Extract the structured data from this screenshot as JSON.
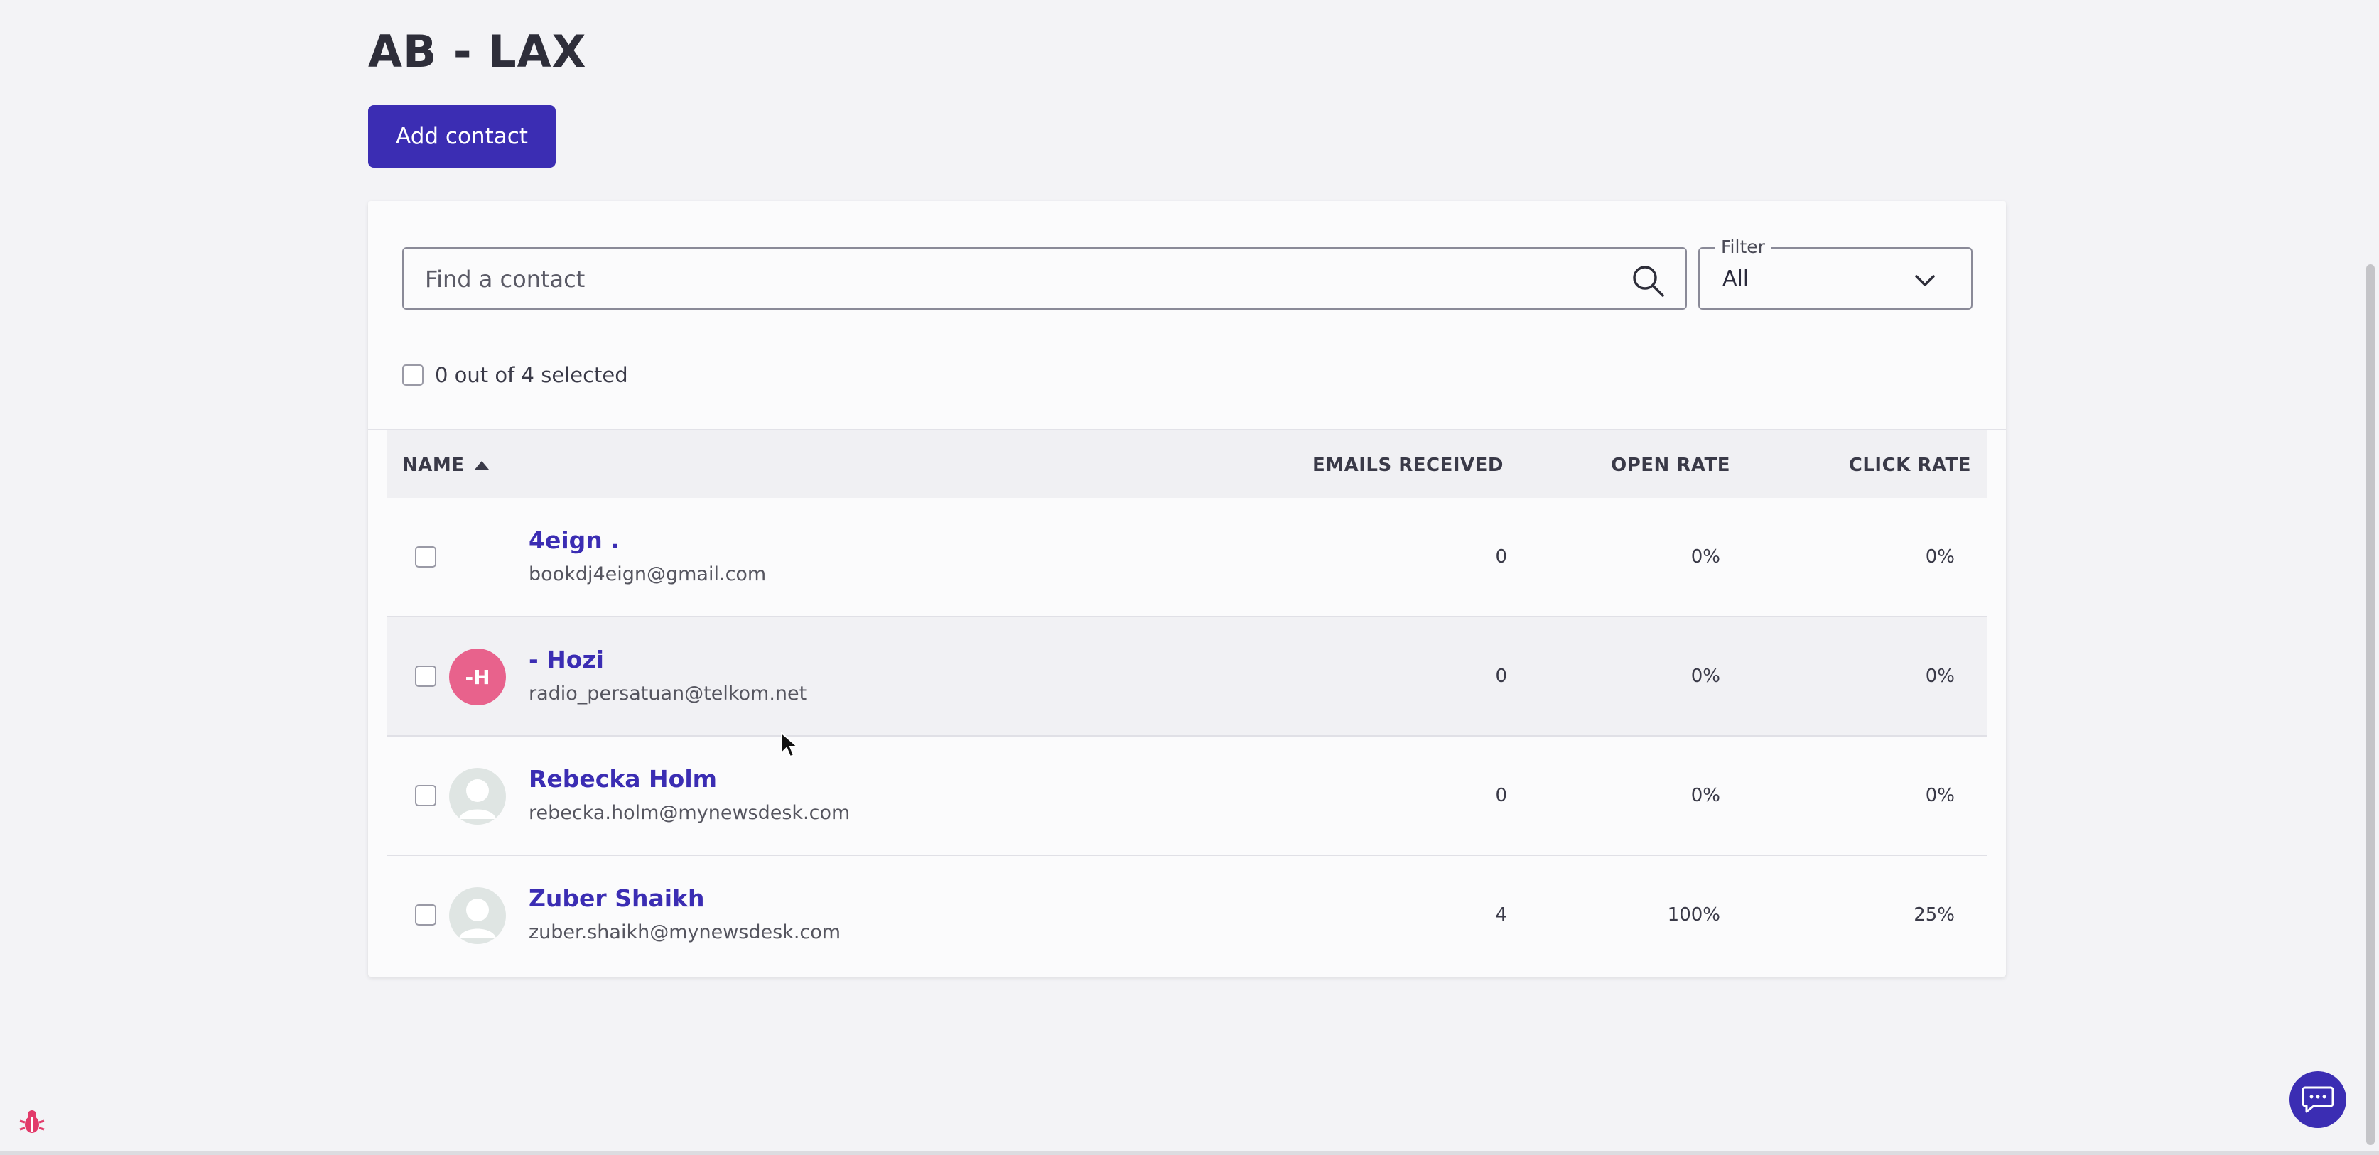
{
  "page": {
    "title": "AB - LAX",
    "add_contact_label": "Add contact"
  },
  "search": {
    "placeholder": "Find a contact",
    "value": ""
  },
  "filter": {
    "label": "Filter",
    "value": "All"
  },
  "selection": {
    "text": "0 out of 4 selected"
  },
  "table": {
    "headers": {
      "name": "NAME",
      "emails": "EMAILS RECEIVED",
      "open": "OPEN RATE",
      "click": "CLICK RATE"
    },
    "sort": {
      "column": "NAME",
      "direction": "ascending"
    },
    "rows": [
      {
        "name": "4eign .",
        "email": "bookdj4eign@gmail.com",
        "avatar": "",
        "emails_received": "0",
        "open_rate": "0%",
        "click_rate": "0%"
      },
      {
        "name": "- Hozi",
        "email": "radio_persatuan@telkom.net",
        "avatar": "-H",
        "emails_received": "0",
        "open_rate": "0%",
        "click_rate": "0%"
      },
      {
        "name": "Rebecka Holm",
        "email": "rebecka.holm@mynewsdesk.com",
        "avatar": "person-icon",
        "emails_received": "0",
        "open_rate": "0%",
        "click_rate": "0%"
      },
      {
        "name": "Zuber Shaikh",
        "email": "zuber.shaikh@mynewsdesk.com",
        "avatar": "person-icon",
        "emails_received": "4",
        "open_rate": "100%",
        "click_rate": "25%"
      }
    ]
  },
  "colors": {
    "accent": "#3b2db3",
    "avatar_pink": "#e8628c",
    "background": "#f3f3f6"
  },
  "icons": {
    "search": "search-icon",
    "filter": "chevron-down-icon",
    "sort": "sort-up-icon",
    "chat": "chat-icon",
    "bug": "bug-icon"
  }
}
